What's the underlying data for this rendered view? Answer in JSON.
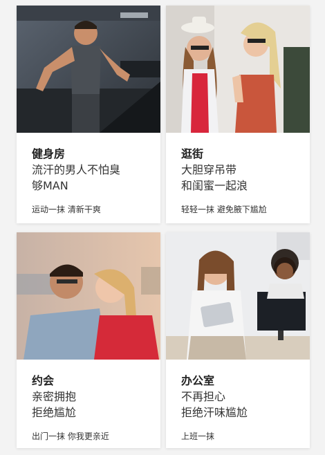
{
  "cards": [
    {
      "title": "健身房",
      "desc_line1": "流汗的男人不怕臭",
      "desc_line2": "够MAN",
      "tagline": "运动一抹 清新干爽",
      "photo": "man-running-on-treadmill"
    },
    {
      "title": "逛街",
      "desc_line1": "大胆穿吊带",
      "desc_line2": "和闺蜜一起浪",
      "tagline": "轻轻一抹 避免腋下尴尬",
      "photo": "two-women-shopping"
    },
    {
      "title": "约会",
      "desc_line1": "亲密拥抱",
      "desc_line2": "拒绝尴尬",
      "tagline": "出门一抹 你我更亲近",
      "photo": "couple-embracing"
    },
    {
      "title": "办公室",
      "desc_line1": "不再担心",
      "desc_line2": "拒绝汗味尴尬",
      "tagline": "上班一抹",
      "photo": "woman-in-office-with-tablet"
    }
  ]
}
